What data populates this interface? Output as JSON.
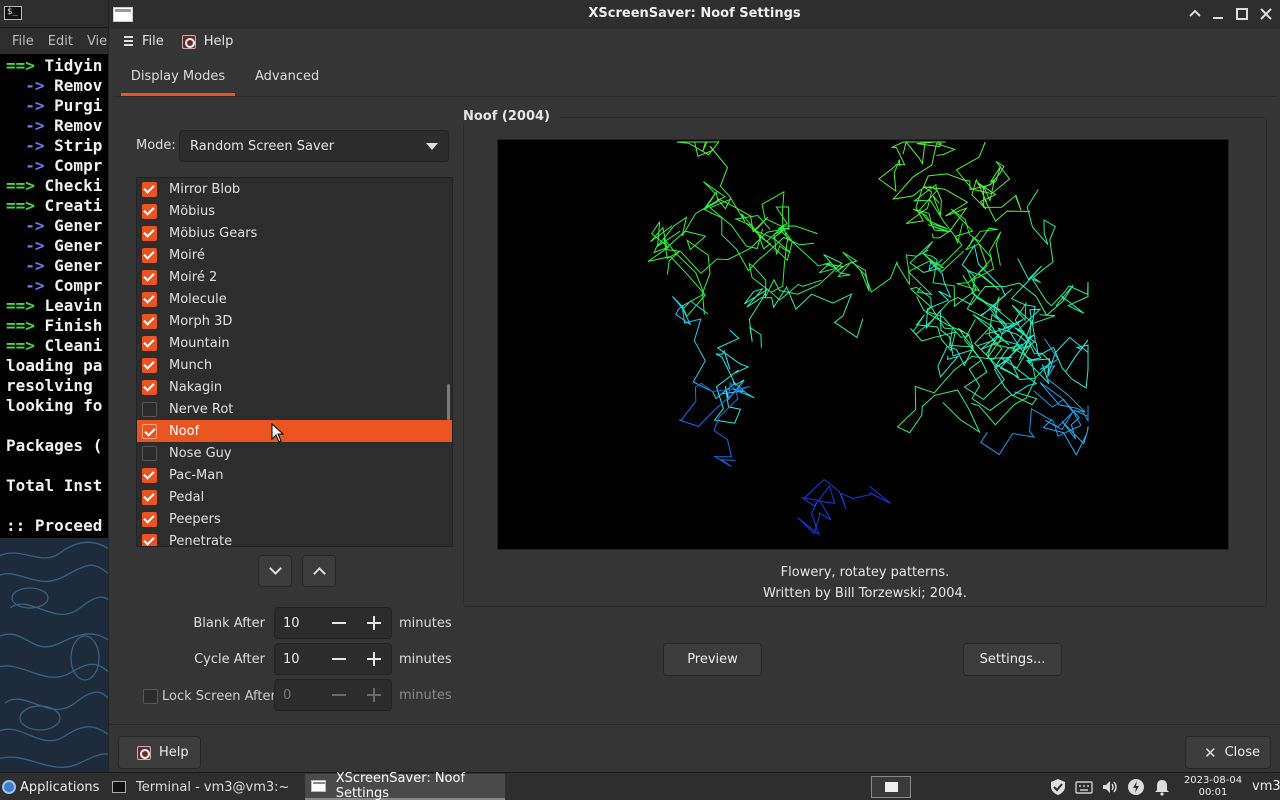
{
  "terminal": {
    "icon_text": "$_",
    "menu": [
      "File",
      "Edit",
      "Vie"
    ],
    "lines": [
      {
        "prefix": "==>",
        "text": " Tidyin",
        "kind": "g"
      },
      {
        "prefix": "  ->",
        "text": " Remov",
        "kind": "b"
      },
      {
        "prefix": "  ->",
        "text": " Purgi",
        "kind": "b"
      },
      {
        "prefix": "  ->",
        "text": " Remov",
        "kind": "b"
      },
      {
        "prefix": "  ->",
        "text": " Strip",
        "kind": "b"
      },
      {
        "prefix": "  ->",
        "text": " Compr",
        "kind": "b"
      },
      {
        "prefix": "==>",
        "text": " Checki",
        "kind": "g"
      },
      {
        "prefix": "==>",
        "text": " Creati",
        "kind": "g"
      },
      {
        "prefix": "  ->",
        "text": " Gener",
        "kind": "b"
      },
      {
        "prefix": "  ->",
        "text": " Gener",
        "kind": "b"
      },
      {
        "prefix": "  ->",
        "text": " Gener",
        "kind": "b"
      },
      {
        "prefix": "  ->",
        "text": " Compr",
        "kind": "b"
      },
      {
        "prefix": "==>",
        "text": " Leavin",
        "kind": "g"
      },
      {
        "prefix": "==>",
        "text": " Finish",
        "kind": "g"
      },
      {
        "prefix": "==>",
        "text": " Cleani",
        "kind": "g"
      },
      {
        "prefix": "",
        "text": "loading pa",
        "kind": "w"
      },
      {
        "prefix": "",
        "text": "resolving ",
        "kind": "w"
      },
      {
        "prefix": "",
        "text": "looking fo",
        "kind": "w"
      },
      {
        "prefix": "",
        "text": "",
        "kind": "w"
      },
      {
        "prefix": "",
        "text": "Packages (",
        "kind": "w"
      },
      {
        "prefix": "",
        "text": "",
        "kind": "w"
      },
      {
        "prefix": "",
        "text": "Total Inst",
        "kind": "w"
      },
      {
        "prefix": "",
        "text": "",
        "kind": "w"
      },
      {
        "prefix": "",
        "text": ":: Proceed",
        "kind": "w"
      }
    ]
  },
  "window": {
    "title": "XScreenSaver: Noof Settings",
    "icons": [
      "shade-icon",
      "minimize-icon",
      "maximize-icon",
      "close-icon"
    ]
  },
  "menubar": {
    "file": "File",
    "help": "Help"
  },
  "tabs": [
    {
      "label": "Display Modes",
      "active": true
    },
    {
      "label": "Advanced",
      "active": false
    }
  ],
  "mode": {
    "label": "Mode:",
    "value": "Random Screen Saver"
  },
  "hacks": [
    {
      "name": "Mirror Blob",
      "checked": true,
      "selected": false
    },
    {
      "name": "Möbius",
      "checked": true,
      "selected": false
    },
    {
      "name": "Möbius Gears",
      "checked": true,
      "selected": false
    },
    {
      "name": "Moiré",
      "checked": true,
      "selected": false
    },
    {
      "name": "Moiré 2",
      "checked": true,
      "selected": false
    },
    {
      "name": "Molecule",
      "checked": true,
      "selected": false
    },
    {
      "name": "Morph 3D",
      "checked": true,
      "selected": false
    },
    {
      "name": "Mountain",
      "checked": true,
      "selected": false
    },
    {
      "name": "Munch",
      "checked": true,
      "selected": false
    },
    {
      "name": "Nakagin",
      "checked": true,
      "selected": false
    },
    {
      "name": "Nerve Rot",
      "checked": false,
      "selected": false
    },
    {
      "name": "Noof",
      "checked": true,
      "selected": true
    },
    {
      "name": "Nose Guy",
      "checked": false,
      "selected": false
    },
    {
      "name": "Pac-Man",
      "checked": true,
      "selected": false
    },
    {
      "name": "Pedal",
      "checked": true,
      "selected": false
    },
    {
      "name": "Peepers",
      "checked": true,
      "selected": false
    },
    {
      "name": "Penetrate",
      "checked": true,
      "selected": false
    }
  ],
  "timers": {
    "blank": {
      "label": "Blank After",
      "value": "10",
      "unit": "minutes"
    },
    "cycle": {
      "label": "Cycle After",
      "value": "10",
      "unit": "minutes"
    },
    "lock": {
      "label": "Lock Screen After",
      "value": "0",
      "unit": "minutes",
      "checked": false
    }
  },
  "preview": {
    "frame_title": "Noof (2004)",
    "description": "Flowery, rotatey patterns.",
    "credit": "Written by Bill Torzewski; 2004.",
    "preview_button": "Preview",
    "settings_button": "Settings..."
  },
  "bottom": {
    "help": "Help",
    "close": "Close"
  },
  "taskbar": {
    "applications": "Applications",
    "terminal_task": "Terminal - vm3@vm3:~",
    "xss_task": "XScreenSaver: Noof Settings",
    "clock_date": "2023-08-04",
    "clock_time": "00:01",
    "user": "vm3"
  },
  "colors": {
    "accent": "#e95420",
    "background": "#353535",
    "terminal_green": "#45d845",
    "terminal_blue": "#6b7bf2"
  }
}
